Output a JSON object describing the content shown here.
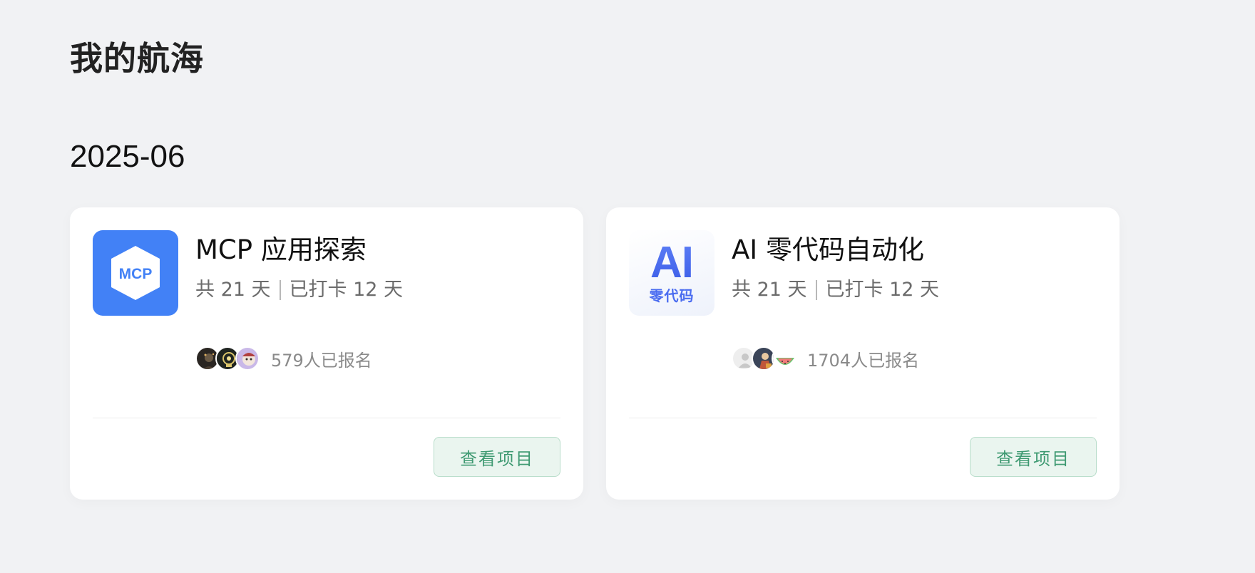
{
  "page": {
    "title": "我的航海"
  },
  "sections": [
    {
      "month": "2025-06",
      "projects": [
        {
          "cover_text": "MCP",
          "cover_color": "#4281f6",
          "title": "MCP 应用探索",
          "total_days": "共 21 天",
          "checked_days": "已打卡 12 天",
          "enrolled": "579人已报名",
          "avatars": [
            "avatar-dark-figure",
            "avatar-lightbulb",
            "avatar-cartoon-character"
          ],
          "button_label": "查看项目"
        },
        {
          "cover_text_main": "AI",
          "cover_text_sub": "零代码",
          "title": "AI 零代码自动化",
          "total_days": "共 21 天",
          "checked_days": "已打卡 12 天",
          "enrolled": "1704人已报名",
          "avatars": [
            "avatar-default-user",
            "avatar-illustration",
            "avatar-watermelon"
          ],
          "button_label": "查看项目"
        }
      ]
    }
  ],
  "colors": {
    "background": "#f1f2f4",
    "card": "#ffffff",
    "button_text": "#3f9a72",
    "button_bg": "#eaf5ef",
    "button_border": "#b8ddca"
  }
}
